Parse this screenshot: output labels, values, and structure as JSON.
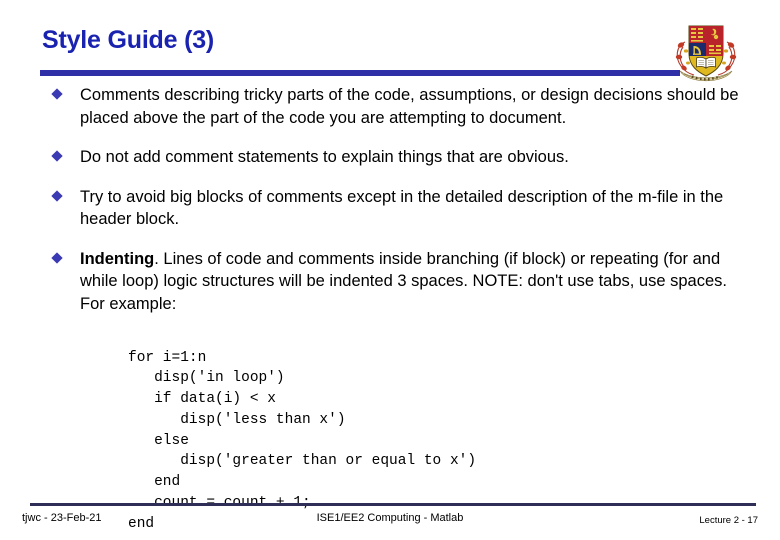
{
  "slide": {
    "title": "Style Guide (3)",
    "title_color": "#1a22b0",
    "rule_color": "#2f2fa8",
    "bullet_color": "#3a3ab4",
    "bullet_glyph": "diamond-bullet",
    "logo_name": "university-crest-logo",
    "bullets": [
      {
        "bold_lead": "",
        "text": "Comments describing tricky parts of the code, assumptions, or design decisions should be placed above the part of the code you are attempting to document."
      },
      {
        "bold_lead": "",
        "text": "Do not add comment statements to explain things that are obvious."
      },
      {
        "bold_lead": "",
        "text": "Try to avoid big blocks of comments except in the detailed description of the m-file in the header block."
      },
      {
        "bold_lead": "Indenting",
        "text": ". Lines of code and comments inside branching (if block) or repeating (for and while loop) logic structures will be indented 3 spaces. NOTE: don't use tabs, use spaces. For example:"
      }
    ],
    "code": "for i=1:n\n   disp('in loop')\n   if data(i) < x\n      disp('less than x')\n   else\n      disp('greater than or equal to x')\n   end\n   count = count + 1;\nend"
  },
  "footer": {
    "left": "tjwc -  23-Feb-21",
    "center": "ISE1/EE2 Computing - Matlab",
    "right": "Lecture 2 -  17",
    "rule_color": "#2e2e56"
  }
}
